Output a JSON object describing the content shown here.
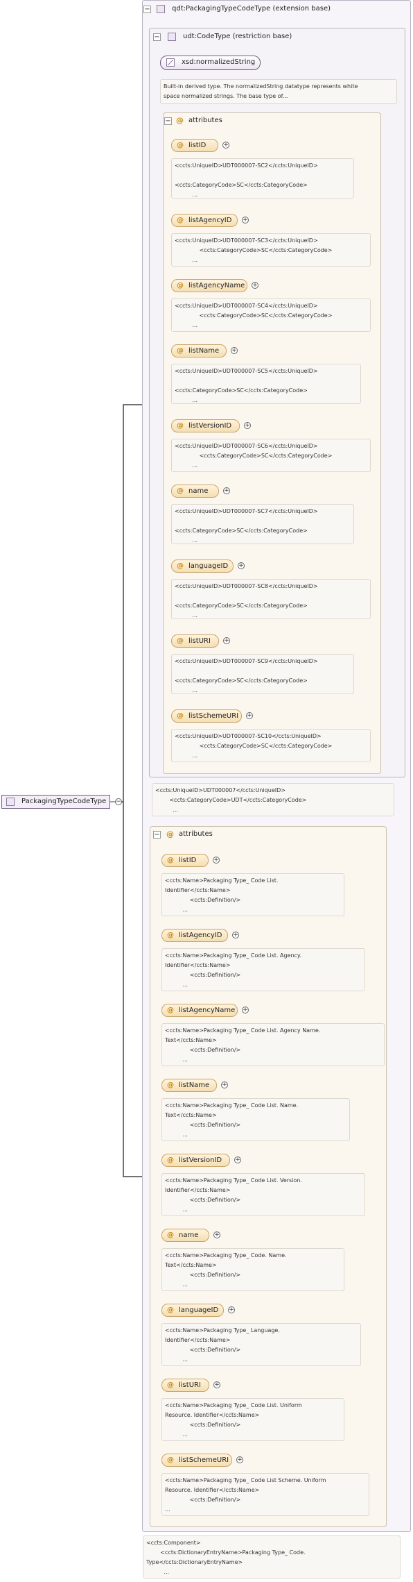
{
  "root": {
    "label": "PackagingTypeCodeType"
  },
  "extension": {
    "label": "qdt:PackagingTypeCodeType (extension base)"
  },
  "restriction": {
    "label": "udt:CodeType (restriction base)"
  },
  "base_type": {
    "label": "xsd:normalizedString"
  },
  "base_doc": {
    "lines": [
      "Built-in derived type. The normalizedString datatype represents white",
      "space normalized strings. The base type of..."
    ]
  },
  "inner_attributes": {
    "label": "attributes",
    "items": [
      {
        "name": "listID",
        "doc": [
          "<ccts:UniqueID>UDT000007-SC2</ccts:UniqueID>",
          "",
          "<ccts:CategoryCode>SC</ccts:CategoryCode>",
          "          ..."
        ]
      },
      {
        "name": "listAgencyID",
        "doc": [
          "<ccts:UniqueID>UDT000007-SC3</ccts:UniqueID>",
          "              <ccts:CategoryCode>SC</ccts:CategoryCode>",
          "          ..."
        ]
      },
      {
        "name": "listAgencyName",
        "doc": [
          "<ccts:UniqueID>UDT000007-SC4</ccts:UniqueID>",
          "              <ccts:CategoryCode>SC</ccts:CategoryCode>",
          "          ..."
        ]
      },
      {
        "name": "listName",
        "doc": [
          "<ccts:UniqueID>UDT000007-SC5</ccts:UniqueID>",
          "",
          "<ccts:CategoryCode>SC</ccts:CategoryCode>",
          "          ..."
        ]
      },
      {
        "name": "listVersionID",
        "doc": [
          "<ccts:UniqueID>UDT000007-SC6</ccts:UniqueID>",
          "              <ccts:CategoryCode>SC</ccts:CategoryCode>",
          "          ..."
        ]
      },
      {
        "name": "name",
        "doc": [
          "<ccts:UniqueID>UDT000007-SC7</ccts:UniqueID>",
          "",
          "<ccts:CategoryCode>SC</ccts:CategoryCode>",
          "          ..."
        ]
      },
      {
        "name": "languageID",
        "doc": [
          "<ccts:UniqueID>UDT000007-SC8</ccts:UniqueID>",
          "",
          "<ccts:CategoryCode>SC</ccts:CategoryCode>",
          "          ..."
        ]
      },
      {
        "name": "listURI",
        "doc": [
          "<ccts:UniqueID>UDT000007-SC9</ccts:UniqueID>",
          "",
          "<ccts:CategoryCode>SC</ccts:CategoryCode>",
          "          ..."
        ]
      },
      {
        "name": "listSchemeURI",
        "doc": [
          "<ccts:UniqueID>UDT000007-SC10</ccts:UniqueID>",
          "              <ccts:CategoryCode>SC</ccts:CategoryCode>",
          "          ..."
        ]
      }
    ]
  },
  "ext_doc": {
    "lines": [
      "<ccts:UniqueID>UDT000007</ccts:UniqueID>",
      "        <ccts:CategoryCode>UDT</ccts:CategoryCode>",
      "          ..."
    ]
  },
  "outer_attributes": {
    "label": "attributes",
    "items": [
      {
        "name": "listID",
        "doc": [
          "<ccts:Name>Packaging Type_ Code List.",
          "Identifier</ccts:Name>",
          "              <ccts:Definition/>",
          "          ..."
        ]
      },
      {
        "name": "listAgencyID",
        "doc": [
          "<ccts:Name>Packaging Type_ Code List. Agency.",
          "Identifier</ccts:Name>",
          "              <ccts:Definition/>",
          "          ..."
        ]
      },
      {
        "name": "listAgencyName",
        "doc": [
          "<ccts:Name>Packaging Type_ Code List. Agency Name.",
          "Text</ccts:Name>",
          "              <ccts:Definition/>",
          "          ..."
        ]
      },
      {
        "name": "listName",
        "doc": [
          "<ccts:Name>Packaging Type_ Code List. Name.",
          "Text</ccts:Name>",
          "              <ccts:Definition/>",
          "          ..."
        ]
      },
      {
        "name": "listVersionID",
        "doc": [
          "<ccts:Name>Packaging Type_ Code List. Version.",
          "Identifier</ccts:Name>",
          "              <ccts:Definition/>",
          "          ..."
        ]
      },
      {
        "name": "name",
        "doc": [
          "<ccts:Name>Packaging Type_ Code. Name.",
          "Text</ccts:Name>",
          "              <ccts:Definition/>",
          "          ..."
        ]
      },
      {
        "name": "languageID",
        "doc": [
          "<ccts:Name>Packaging Type_ Language.",
          "Identifier</ccts:Name>",
          "              <ccts:Definition/>",
          "          ..."
        ]
      },
      {
        "name": "listURI",
        "doc": [
          "<ccts:Name>Packaging Type_ Code List. Uniform",
          "Resource. Identifier</ccts:Name>",
          "              <ccts:Definition/>",
          "          ..."
        ]
      },
      {
        "name": "listSchemeURI",
        "doc": [
          "<ccts:Name>Packaging Type_ Code List Scheme. Uniform",
          "Resource. Identifier</ccts:Name>",
          "              <ccts:Definition/>",
          "..."
        ]
      }
    ]
  },
  "component_doc": {
    "lines": [
      "<ccts:Component>",
      "        <ccts:DictionaryEntryName>Packaging Type_ Code.",
      "Type</ccts:DictionaryEntryName>",
      "          ..."
    ]
  }
}
